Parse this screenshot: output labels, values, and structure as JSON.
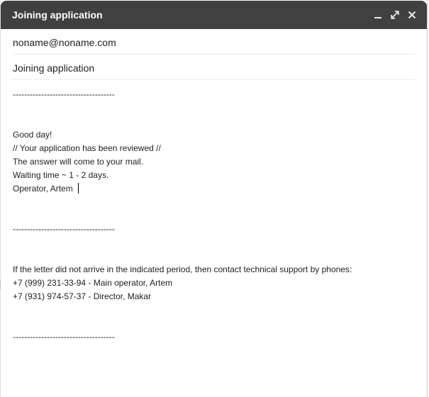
{
  "window": {
    "title": "Joining application",
    "controls": {
      "minimize": "minimize-icon",
      "maximize": "expand-icon",
      "close": "close-icon"
    },
    "colors": {
      "titlebar": "#404040",
      "title_text": "#ffffff"
    }
  },
  "compose": {
    "to": "noname@noname.com",
    "subject": "Joining application",
    "body": {
      "separator_1": "------------------------------------",
      "greeting": "Good day!",
      "line_reviewed": "// Your application has been reviewed //",
      "line_answer": "The answer will come to your mail.",
      "line_waiting": "Waiting time ~ 1 - 2 days.",
      "line_signature": "Operator, Artem",
      "separator_2": "------------------------------------",
      "support_intro": "If the letter did not arrive in the indicated period, then contact technical support by phones:",
      "phone_1": "+7 (999) 231-33-94 - Main operator, Artem",
      "phone_2": "+7 (931) 974-57-37 - Director, Makar",
      "separator_3": "------------------------------------"
    }
  }
}
